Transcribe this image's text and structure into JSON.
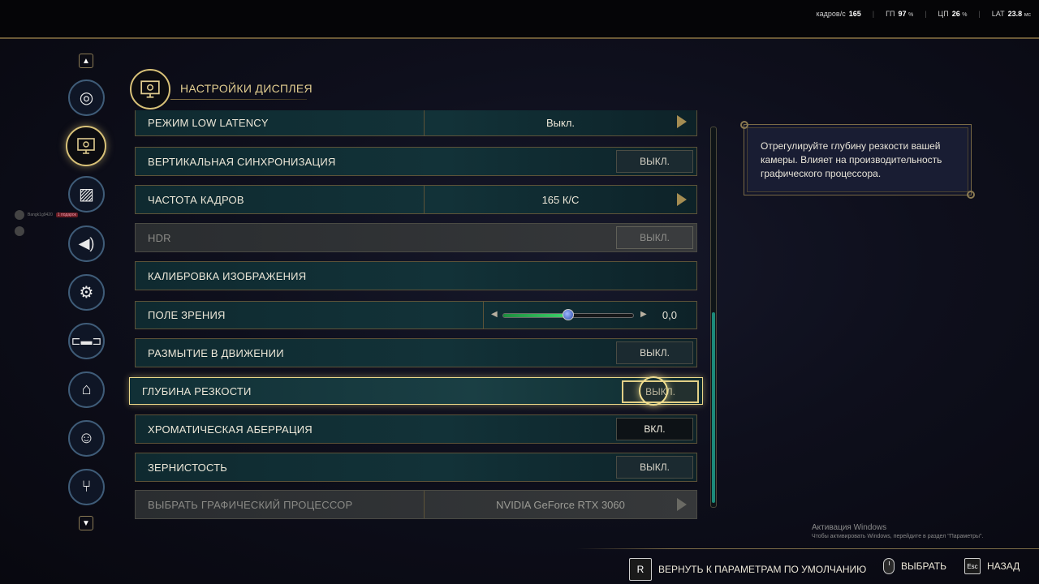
{
  "stats": {
    "fps_label": "кадров/с",
    "fps_value": "165",
    "gpu_label": "ГП",
    "gpu_value": "97",
    "gpu_unit": "%",
    "cpu_label": "ЦП",
    "cpu_value": "26",
    "cpu_unit": "%",
    "lat_label": "LAT",
    "lat_value": "23.8",
    "lat_unit": "мс"
  },
  "header": {
    "title": "НАСТРОЙКИ ДИСПЛЕЯ"
  },
  "sidebar": {
    "items": [
      {
        "name": "disc-icon",
        "glyph": "◎"
      },
      {
        "name": "monitor-gear-icon",
        "glyph": "▭"
      },
      {
        "name": "image-icon",
        "glyph": "▨"
      },
      {
        "name": "speaker-icon",
        "glyph": "🔊"
      },
      {
        "name": "gear-icon",
        "glyph": "⚙"
      },
      {
        "name": "gamepad-icon",
        "glyph": "🎮"
      },
      {
        "name": "mouse-icon",
        "glyph": "🖱"
      },
      {
        "name": "accessibility-icon",
        "glyph": "♿"
      },
      {
        "name": "network-icon",
        "glyph": "⑂"
      }
    ]
  },
  "chat": {
    "user": "Bangk1g9420",
    "tag": "1 подарок"
  },
  "settings": {
    "low_latency": {
      "label": "РЕЖИМ LOW LATENCY",
      "value": "Выкл."
    },
    "vsync": {
      "label": "ВЕРТИКАЛЬНАЯ СИНХРОНИЗАЦИЯ",
      "value": "ВЫКЛ."
    },
    "framerate": {
      "label": "ЧАСТОТА КАДРОВ",
      "value": "165 К/С"
    },
    "hdr": {
      "label": "HDR",
      "value": "ВЫКЛ."
    },
    "calibration": {
      "label": "КАЛИБРОВКА ИЗОБРАЖЕНИЯ"
    },
    "fov": {
      "label": "ПОЛЕ ЗРЕНИЯ",
      "value": "0,0",
      "fill_fraction": 0.5
    },
    "motion_blur": {
      "label": "РАЗМЫТИЕ В ДВИЖЕНИИ",
      "value": "ВЫКЛ."
    },
    "dof": {
      "label": "ГЛУБИНА РЕЗКОСТИ",
      "value": "ВЫКЛ."
    },
    "chromatic": {
      "label": "ХРОМАТИЧЕСКАЯ АБЕРРАЦИЯ",
      "value": "ВКЛ."
    },
    "grain": {
      "label": "ЗЕРНИСТОСТЬ",
      "value": "ВЫКЛ."
    },
    "gpu_select": {
      "label": "ВЫБРАТЬ ГРАФИЧЕСКИЙ ПРОЦЕССОР",
      "value": "NVIDIA GeForce RTX 3060"
    }
  },
  "description": "Отрегулируйте глубину резкости вашей камеры. Влияет на производительность графического процессора.",
  "watermark": {
    "title": "Активация Windows",
    "subtitle": "Чтобы активировать Windows, перейдите в раздел \"Параметры\"."
  },
  "footer": {
    "reset_key": "R",
    "reset_label": "ВЕРНУТЬ К ПАРАМЕТРАМ ПО УМОЛЧАНИЮ",
    "select_label": "ВЫБРАТЬ",
    "back_key": "Esc",
    "back_label": "НАЗАД"
  },
  "colors": {
    "accent_gold": "#d8c178",
    "row_bg": "#123238",
    "slider_green": "#3ed36c"
  }
}
